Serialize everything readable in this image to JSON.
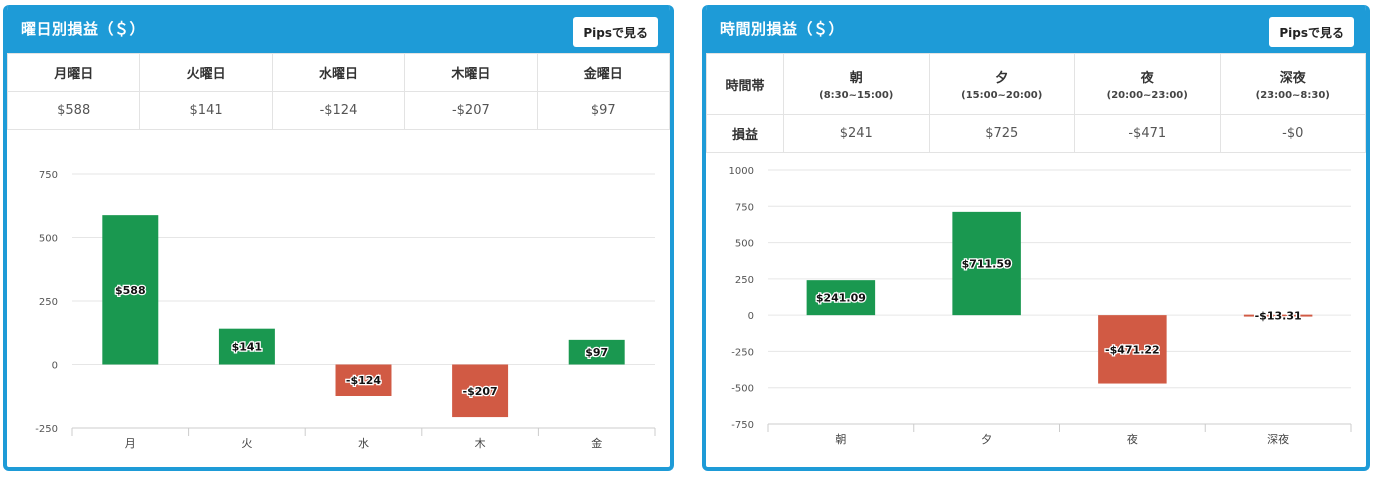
{
  "left_panel": {
    "title": "曜日別損益（＄）",
    "pips_button": "Pipsで見る",
    "headers": [
      "月曜日",
      "火曜日",
      "水曜日",
      "木曜日",
      "金曜日"
    ],
    "values": [
      "$588",
      "$141",
      "-$124",
      "-$207",
      "$97"
    ]
  },
  "right_panel": {
    "title": "時間別損益（＄）",
    "pips_button": "Pipsで見る",
    "row_header_1": "時間帯",
    "row_header_2": "損益",
    "headers": [
      {
        "name": "朝",
        "range": "(8:30~15:00)"
      },
      {
        "name": "夕",
        "range": "(15:00~20:00)"
      },
      {
        "name": "夜",
        "range": "(20:00~23:00)"
      },
      {
        "name": "深夜",
        "range": "(23:00~8:30)"
      }
    ],
    "values": [
      "$241",
      "$725",
      "-$471",
      "-$0"
    ]
  },
  "colors": {
    "positive": "#1a9850",
    "negative": "#d15a44",
    "header": "#1e9bd7"
  },
  "chart_data": [
    {
      "type": "bar",
      "categories": [
        "月",
        "火",
        "水",
        "木",
        "金"
      ],
      "values": [
        588,
        141,
        -124,
        -207,
        97
      ],
      "labels": [
        "$588",
        "$141",
        "-$124",
        "-$207",
        "$97"
      ],
      "yticks": [
        750,
        500,
        250,
        0,
        -250
      ],
      "ylim": [
        -250,
        750
      ],
      "grid": true
    },
    {
      "type": "bar",
      "categories": [
        "朝",
        "夕",
        "夜",
        "深夜"
      ],
      "values": [
        241.09,
        711.59,
        -471.22,
        -13.31
      ],
      "labels": [
        "$241.09",
        "$711.59",
        "-$471.22",
        "-$13.31"
      ],
      "yticks": [
        1000,
        750,
        500,
        250,
        0,
        -250,
        -500,
        -750
      ],
      "ylim": [
        -750,
        1000
      ],
      "grid": true
    }
  ]
}
